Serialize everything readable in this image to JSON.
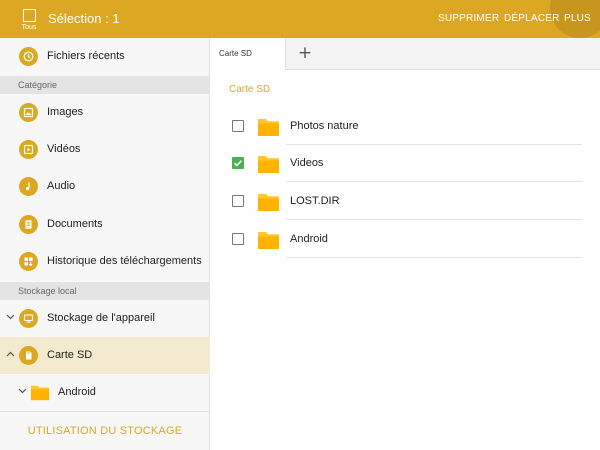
{
  "topbar": {
    "select_all_label": "Tous",
    "selection_title": "Sélection : 1",
    "actions": {
      "delete": "SUPPRIMER",
      "move": "DÉPLACER",
      "more": "PLUS"
    }
  },
  "colors": {
    "accent": "#dca823",
    "accent_dark": "#c7961f",
    "check_on": "#4caf50",
    "folder": "#ffc72c"
  },
  "sidebar": {
    "recent": {
      "label": "Fichiers récents",
      "icon": "clock-icon"
    },
    "category_header": "Catégorie",
    "categories": [
      {
        "label": "Images",
        "icon": "image-icon"
      },
      {
        "label": "Vidéos",
        "icon": "video-icon"
      },
      {
        "label": "Audio",
        "icon": "music-note-icon"
      },
      {
        "label": "Documents",
        "icon": "document-icon"
      },
      {
        "label": "Historique des téléchargements",
        "icon": "download-history-icon"
      }
    ],
    "storage_header": "Stockage local",
    "storage": [
      {
        "label": "Stockage de l'appareil",
        "icon": "device-icon",
        "expanded": false
      },
      {
        "label": "Carte SD",
        "icon": "sd-card-icon",
        "expanded": true,
        "active": true
      }
    ],
    "tree_child": {
      "label": "Android",
      "icon": "folder-icon"
    },
    "usage_button": "UTILISATION DU STOCKAGE"
  },
  "tabs": [
    {
      "label": "Carte SD",
      "active": true
    }
  ],
  "add_tab_icon": "plus-icon",
  "breadcrumb": "Carte SD",
  "files": [
    {
      "name": "Photos nature",
      "checked": false
    },
    {
      "name": "Videos",
      "checked": true
    },
    {
      "name": "LOST.DIR",
      "checked": false
    },
    {
      "name": "Android",
      "checked": false
    }
  ]
}
